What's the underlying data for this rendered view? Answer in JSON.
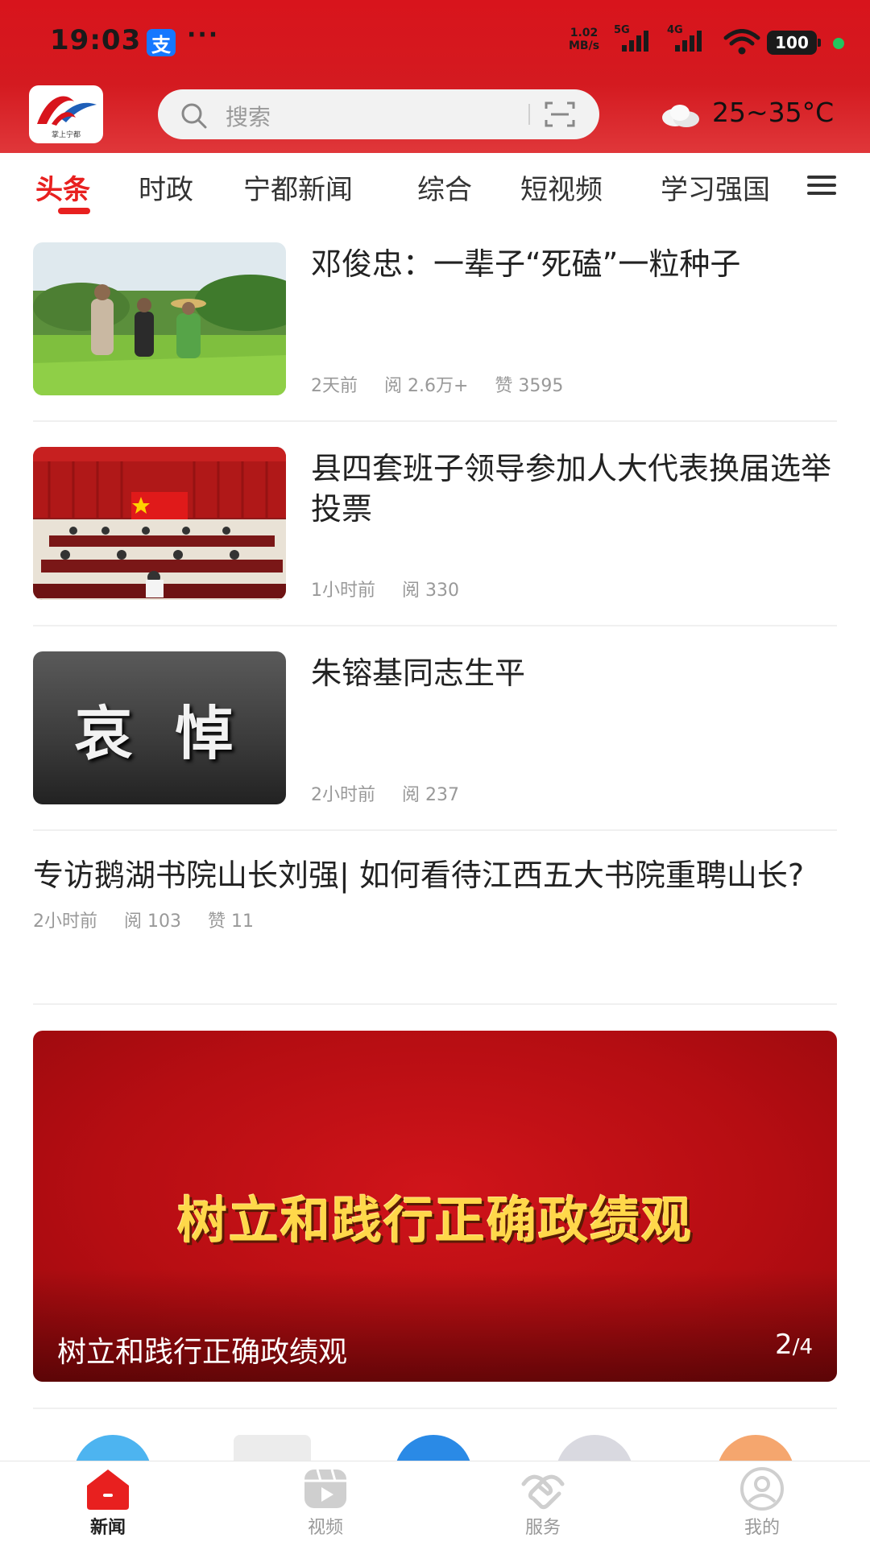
{
  "status_bar": {
    "time": "19:03",
    "alipay_glyph": "支",
    "more": "···",
    "net_speed_value": "1.02",
    "net_speed_unit": "MB/s",
    "sim1": "5G",
    "sim2": "4G",
    "battery": "100"
  },
  "header": {
    "logo_text": "掌上宁都",
    "search_placeholder": "搜索",
    "weather_temp": "25~35°C"
  },
  "tabs": [
    {
      "label": "头条",
      "active": true
    },
    {
      "label": "时政"
    },
    {
      "label": "宁都新闻"
    },
    {
      "label": "综合"
    },
    {
      "label": "短视频"
    },
    {
      "label": "学习强国"
    }
  ],
  "news": [
    {
      "title": "邓俊忠：一辈子“死磕”一粒种子",
      "time": "2天前",
      "reads": "阅 2.6万+",
      "likes": "赞 3595"
    },
    {
      "title": "县四套班子领导参加人大代表换届选举投票",
      "time": "1小时前",
      "reads": "阅 330"
    },
    {
      "title": "朱镕基同志生平",
      "time": "2小时前",
      "reads": "阅 237",
      "thumb_text": "哀 悼"
    },
    {
      "title": "专访鹅湖书院山长刘强| 如何看待江西五大书院重聘山长?",
      "time": "2小时前",
      "reads": "阅 103",
      "likes": "赞 11"
    }
  ],
  "banner": {
    "headline": "树立和践行正确政绩观",
    "caption": "树立和践行正确政绩观",
    "current": "2",
    "total": "/4"
  },
  "bottom_nav": [
    {
      "label": "新闻",
      "icon": "home-icon",
      "active": true
    },
    {
      "label": "视频",
      "icon": "video-icon"
    },
    {
      "label": "服务",
      "icon": "handshake-icon"
    },
    {
      "label": "我的",
      "icon": "user-icon"
    }
  ],
  "colors": {
    "brand_red": "#d8141c",
    "active_tab": "#e8201f",
    "banner_text": "#ffd84a"
  }
}
